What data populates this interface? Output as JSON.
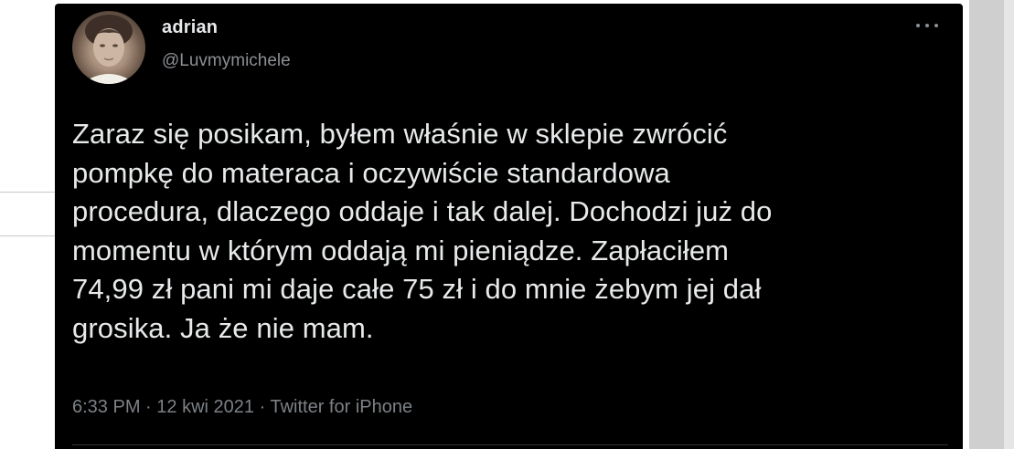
{
  "tweet": {
    "author": {
      "display_name": "adrian",
      "handle": "@Luvmymichele",
      "avatar_icon": "profile-photo"
    },
    "more_icon": "ellipsis-icon",
    "text_lines": [
      "Zaraz się posikam, byłem właśnie w sklepie zwrócić",
      "pompkę do materaca i oczywiście standardowa",
      "procedura, dlaczego oddaje i tak dalej. Dochodzi już do",
      "momentu w którym oddają mi pieniądze. Zapłaciłem",
      "74,99 zł pani mi daje całe 75 zł i do mnie żebym jej dał",
      "grosika. Ja że nie mam."
    ],
    "meta": {
      "time": "6:33 PM",
      "separator": "·",
      "date": "12 kwi 2021",
      "source": "Twitter for iPhone"
    }
  },
  "colors": {
    "card_background": "#000000",
    "primary_text": "#e7e9ea",
    "secondary_text": "#8b9095"
  }
}
